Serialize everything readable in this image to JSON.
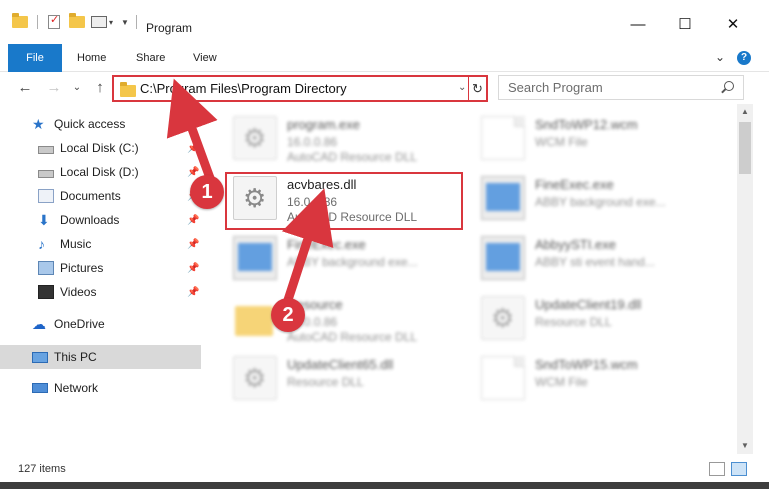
{
  "window": {
    "title": "Program",
    "minimize_glyph": "—",
    "maximize_glyph": "☐",
    "close_glyph": "✕"
  },
  "ribbon": {
    "tabs": [
      "File",
      "Home",
      "Share",
      "View"
    ],
    "expand_glyph": "⌄",
    "help_glyph": "?"
  },
  "nav": {
    "back_glyph": "←",
    "forward_glyph": "→",
    "recent_glyph": "⌄",
    "up_glyph": "↑",
    "address": "C:\\Program Files\\Program Directory",
    "dropdown_glyph": "⌄",
    "refresh_glyph": "↻",
    "search_placeholder": "Search Program"
  },
  "sidebar": {
    "quick_access": "Quick access",
    "items": [
      {
        "label": "Local Disk (C:)",
        "icon": "drive-icon"
      },
      {
        "label": "Local Disk (D:)",
        "icon": "drive-icon"
      },
      {
        "label": "Documents",
        "icon": "documents-icon"
      },
      {
        "label": "Downloads",
        "icon": "downloads-icon"
      },
      {
        "label": "Music",
        "icon": "music-icon"
      },
      {
        "label": "Pictures",
        "icon": "pictures-icon"
      },
      {
        "label": "Videos",
        "icon": "videos-icon"
      }
    ],
    "onedrive": "OneDrive",
    "this_pc": "This PC",
    "network": "Network"
  },
  "files": [
    {
      "name": "program.exe",
      "line1": "16.0.0.86",
      "line2": "AutoCAD Resource DLL"
    },
    {
      "name": "SndToWP12.wcm",
      "line1": "WCM File",
      "line2": ""
    },
    {
      "name": "acvbares.dll",
      "line1": "16.0.0.86",
      "line2": "AutoCAD Resource DLL"
    },
    {
      "name": "FineExec.exe",
      "line1": "ABBY background exe...",
      "line2": ""
    },
    {
      "name": "FineExec.exe",
      "line1": "ABBY background exe...",
      "line2": ""
    },
    {
      "name": "AbbyySTI.exe",
      "line1": "ABBY sti event hand...",
      "line2": ""
    },
    {
      "name": "Resource",
      "line1": "16.0.0.86",
      "line2": "AutoCAD Resource DLL"
    },
    {
      "name": "UpdateClient19.dll",
      "line1": "Resource DLL",
      "line2": ""
    },
    {
      "name": "UpdateClient65.dll",
      "line1": "Resource DLL",
      "line2": ""
    },
    {
      "name": "SndToWP15.wcm",
      "line1": "WCM File",
      "line2": ""
    }
  ],
  "annotations": {
    "badge_1": "1",
    "badge_2": "2",
    "color": "#d9363e"
  },
  "status": {
    "item_count": "127 items"
  },
  "colors": {
    "accent": "#1979ca",
    "highlight": "#d9363e"
  }
}
